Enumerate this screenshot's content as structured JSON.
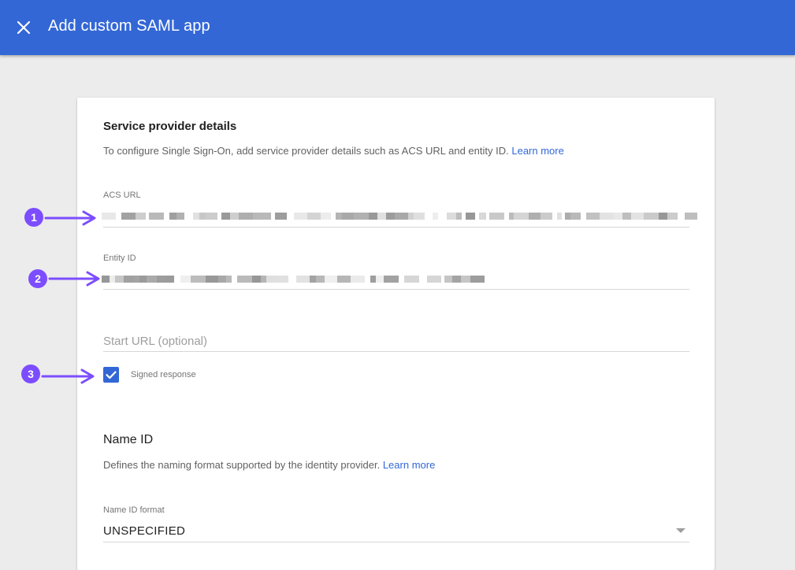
{
  "header": {
    "close_icon": "close-icon",
    "title": "Add custom SAML app"
  },
  "service_provider": {
    "title": "Service provider details",
    "description": "To configure Single Sign-On, add service provider details such as ACS URL and entity ID.",
    "learn_more": "Learn more",
    "acs_url_label": "ACS URL",
    "entity_id_label": "Entity ID",
    "start_url_placeholder": "Start URL (optional)",
    "signed_response_label": "Signed response",
    "signed_response_checked": true
  },
  "name_id": {
    "title": "Name ID",
    "description": "Defines the naming format supported by the identity provider.",
    "learn_more": "Learn more",
    "format_label": "Name ID format",
    "format_value": "UNSPECIFIED"
  },
  "annotations": [
    "1",
    "2",
    "3"
  ],
  "colors": {
    "header_bg": "#3367d6",
    "accent": "#3367d6",
    "annotation": "#7c4dff"
  }
}
